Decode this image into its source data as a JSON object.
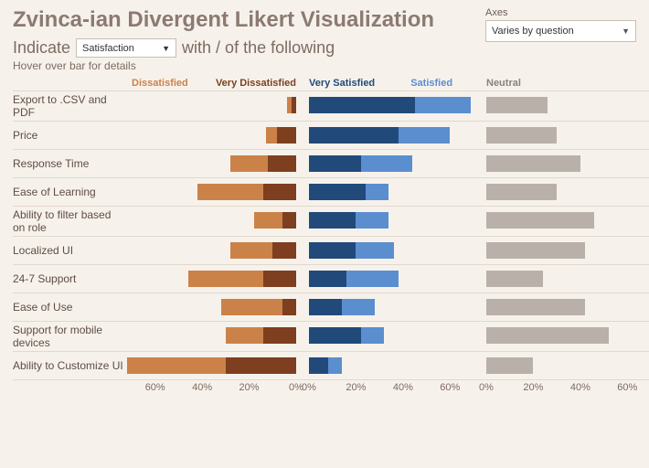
{
  "title": "Zvinca-ian Divergent Likert Visualization",
  "controls": {
    "axes_label": "Axes",
    "axes_value": "Varies by question",
    "indicate_prefix": "Indicate",
    "indicate_value": "Satisfaction",
    "indicate_suffix": "with / of the following",
    "hint": "Hover over bar for details"
  },
  "legend": {
    "dissatisfied": "Dissatisfied",
    "very_dissatisfied": "Very Dissatisfied",
    "very_satisfied": "Very Satisfied",
    "satisfied": "Satisfied",
    "neutral": "Neutral"
  },
  "axis_neg": [
    "60%",
    "40%",
    "20%",
    "0%"
  ],
  "axis_pos": [
    "0%",
    "20%",
    "40%",
    "60%"
  ],
  "axis_neu": [
    "0%",
    "20%",
    "40%",
    "60%"
  ],
  "chart_data": {
    "type": "bar",
    "subtype": "diverging-likert",
    "categories": [
      "Export to .CSV and PDF",
      "Price",
      "Response Time",
      "Ease of Learning",
      "Ability to filter based on role",
      "Localized UI",
      "24-7 Support",
      "Ease of Use",
      "Support for mobile devices",
      "Ability to Customize UI"
    ],
    "series": [
      {
        "name": "Dissatisfied",
        "values": [
          2,
          5,
          16,
          28,
          12,
          18,
          32,
          26,
          16,
          42
        ]
      },
      {
        "name": "Very Dissatisfied",
        "values": [
          2,
          8,
          12,
          14,
          6,
          10,
          14,
          6,
          14,
          30
        ]
      },
      {
        "name": "Very Satisfied",
        "values": [
          45,
          38,
          22,
          24,
          20,
          20,
          16,
          14,
          22,
          8
        ]
      },
      {
        "name": "Satisfied",
        "values": [
          24,
          22,
          22,
          10,
          14,
          16,
          22,
          14,
          10,
          6
        ]
      },
      {
        "name": "Neutral",
        "values": [
          26,
          30,
          40,
          30,
          46,
          42,
          24,
          42,
          52,
          20
        ]
      }
    ],
    "xlabel": "",
    "ylabel": "",
    "neg_range": [
      0,
      70
    ],
    "pos_range": [
      0,
      70
    ],
    "neu_range": [
      0,
      70
    ]
  }
}
